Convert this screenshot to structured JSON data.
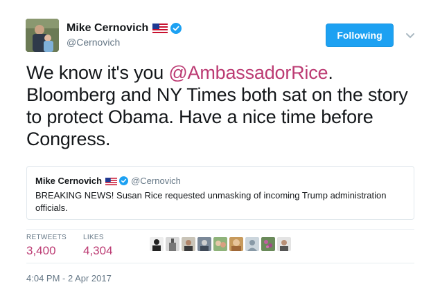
{
  "author": {
    "display_name": "Mike Cernovich",
    "handle": "@Cernovich",
    "verified": true,
    "flag_icon": "us-flag-icon"
  },
  "follow_button": {
    "label": "Following",
    "color": "#1da1f2"
  },
  "tweet": {
    "text_before": "We know it's you ",
    "mention": "@AmbassadorRice",
    "text_after": ". Bloomberg and NY Times both sat on the story to protect Obama. Have a nice  time before Congress.",
    "mention_color": "#bc3b73"
  },
  "quoted_tweet": {
    "display_name": "Mike Cernovich",
    "handle": "@Cernovich",
    "text": "BREAKING NEWS! Susan Rice requested unmasking of incoming Trump administration officials."
  },
  "stats": {
    "retweets_label": "RETWEETS",
    "retweets_value": "3,400",
    "likes_label": "LIKES",
    "likes_value": "4,304",
    "value_color": "#bc3b73"
  },
  "liker_avatars": [
    {
      "icon": "liker-avatar-1"
    },
    {
      "icon": "liker-avatar-2"
    },
    {
      "icon": "liker-avatar-3"
    },
    {
      "icon": "liker-avatar-4"
    },
    {
      "icon": "liker-avatar-5"
    },
    {
      "icon": "liker-avatar-6"
    },
    {
      "icon": "liker-avatar-7"
    },
    {
      "icon": "liker-avatar-8"
    },
    {
      "icon": "liker-avatar-9"
    }
  ],
  "timestamp": "4:04 PM - 2 Apr 2017"
}
